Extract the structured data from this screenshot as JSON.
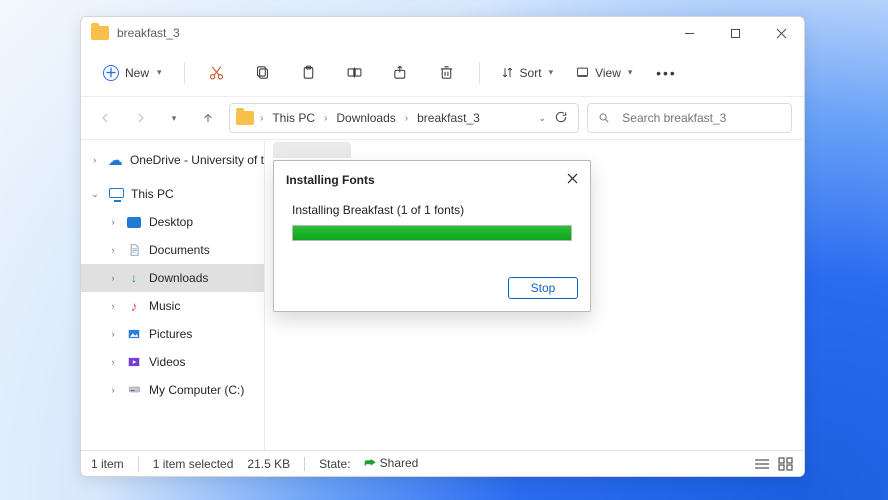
{
  "window": {
    "title": "breakfast_3"
  },
  "toolbar": {
    "new_label": "New",
    "sort_label": "Sort",
    "view_label": "View"
  },
  "address": {
    "crumbs": [
      "This PC",
      "Downloads",
      "breakfast_3"
    ]
  },
  "search": {
    "placeholder": "Search breakfast_3"
  },
  "sidebar": {
    "onedrive_label": "OneDrive - University of t",
    "thispc_label": "This PC",
    "items": [
      {
        "label": "Desktop"
      },
      {
        "label": "Documents"
      },
      {
        "label": "Downloads"
      },
      {
        "label": "Music"
      },
      {
        "label": "Pictures"
      },
      {
        "label": "Videos"
      },
      {
        "label": "My Computer (C:)"
      }
    ]
  },
  "dialog": {
    "title": "Installing Fonts",
    "status": "Installing Breakfast (1 of 1 fonts)",
    "stop_label": "Stop"
  },
  "statusbar": {
    "count": "1 item",
    "selected": "1 item selected",
    "size": "21.5 KB",
    "state_label": "State:",
    "state_value": "Shared"
  }
}
